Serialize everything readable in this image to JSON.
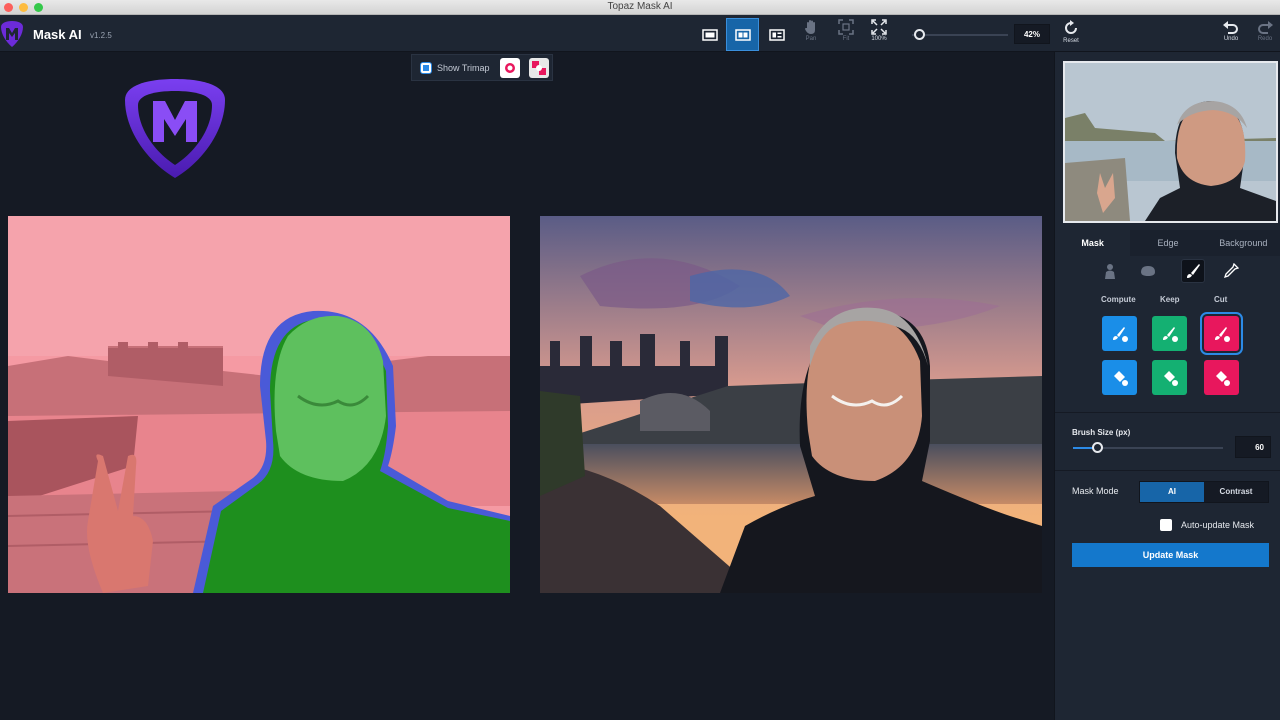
{
  "window": {
    "title": "Topaz Mask AI"
  },
  "app": {
    "name": "Mask AI",
    "version": "v1.2.5"
  },
  "toolbar": {
    "pan_label": "Pan",
    "fit_label": "Fit",
    "actual_label": "100%",
    "zoom_value": "42%",
    "reset_label": "Reset",
    "undo_label": "Undo",
    "redo_label": "Redo"
  },
  "canvas": {
    "show_trimap_label": "Show Trimap"
  },
  "panel": {
    "tabs": [
      "Mask",
      "Edge",
      "Background"
    ],
    "active_tab": "Mask",
    "columns": {
      "compute": "Compute",
      "keep": "Keep",
      "cut": "Cut"
    },
    "brush_size_label": "Brush Size (px)",
    "brush_size_value": "60",
    "mask_mode_label": "Mask Mode",
    "mask_mode_options": [
      "AI",
      "Contrast"
    ],
    "mask_mode_selected": "AI",
    "auto_update_label": "Auto-update Mask",
    "update_button": "Update Mask"
  },
  "colors": {
    "accent": "#1478cc",
    "compute": "#1a8ee8",
    "keep": "#14b072",
    "cut": "#e8175d",
    "mask_keep": "#2aa02a",
    "mask_cut": "#ff8a95"
  }
}
